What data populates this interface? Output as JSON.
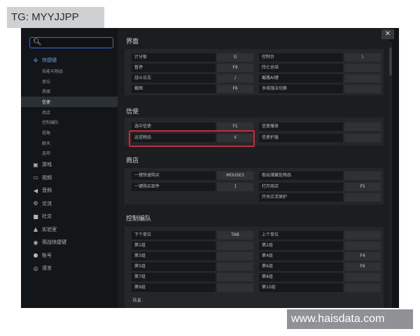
{
  "watermarks": {
    "top_left": "TG: MYYJJPP",
    "bottom_right": "www.haisdata.com"
  },
  "search": {
    "placeholder": ""
  },
  "nav": {
    "hotkeys": "快捷键",
    "subitems": [
      "技能与物品",
      "单位",
      "界面",
      "信使",
      "商店",
      "控制编队",
      "视角",
      "聊天",
      "选项"
    ],
    "categories": [
      "游戏",
      "视频",
      "音频",
      "交流",
      "社交",
      "实验室",
      "观战快捷键",
      "账号",
      "语言"
    ]
  },
  "sections": {
    "interface": {
      "title": "界面",
      "left": [
        {
          "label": "计分板",
          "key": "G"
        },
        {
          "label": "暂停",
          "key": "F9"
        },
        {
          "label": "战斗日志",
          "key": "/"
        },
        {
          "label": "截图",
          "key": "F6"
        }
      ],
      "right": [
        {
          "label": "控制台",
          "key": "\\"
        },
        {
          "label": "阵亡总结",
          "key": ""
        },
        {
          "label": "截路AI键",
          "key": ""
        },
        {
          "label": "多择施法切换",
          "key": ""
        }
      ]
    },
    "courier": {
      "title": "信使",
      "left": [
        {
          "label": "选中信使",
          "key": "F1"
        },
        {
          "label": "运送物品",
          "key": "V"
        }
      ],
      "right": [
        {
          "label": "信使爆发",
          "key": ""
        },
        {
          "label": "信使护盾",
          "key": ""
        }
      ]
    },
    "shop": {
      "title": "商店",
      "left": [
        {
          "label": "一键快速购买",
          "key": "MOUSE3"
        },
        {
          "label": "一键购买部件",
          "key": "]"
        }
      ],
      "right": [
        {
          "label": "取出储藏处物品",
          "key": ""
        },
        {
          "label": "打开商店",
          "key": "F5"
        },
        {
          "label": "开关买活保护",
          "key": ""
        }
      ]
    },
    "control": {
      "title": "控制编队",
      "left": [
        {
          "label": "下个单位",
          "key": "TAB"
        },
        {
          "label": "第1组",
          "key": ""
        },
        {
          "label": "第3组",
          "key": ""
        },
        {
          "label": "第5组",
          "key": ""
        },
        {
          "label": "第7组",
          "key": ""
        },
        {
          "label": "第9组",
          "key": ""
        }
      ],
      "right": [
        {
          "label": "上个单位",
          "key": ""
        },
        {
          "label": "第2组",
          "key": ""
        },
        {
          "label": "第4组",
          "key": "F4"
        },
        {
          "label": "第6组",
          "key": "F6"
        },
        {
          "label": "第8组",
          "key": ""
        },
        {
          "label": "第10组",
          "key": ""
        }
      ],
      "sub_title": "队友"
    }
  },
  "colors": {
    "highlight": "#d0263a",
    "accent": "#6f9bd4",
    "search_border": "#4b6f9e"
  }
}
